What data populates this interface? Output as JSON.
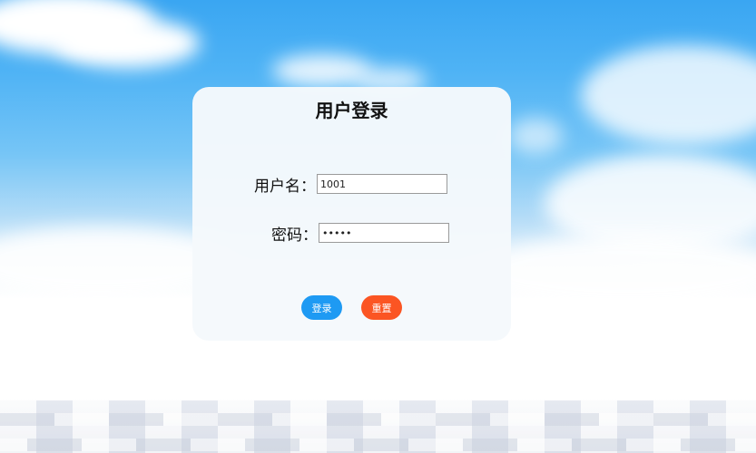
{
  "login": {
    "title": "用户登录",
    "username_label": "用户名：",
    "username_value": "1001",
    "password_label": "密码：",
    "password_value": "12345",
    "login_button": "登录",
    "reset_button": "重置"
  },
  "colors": {
    "login_button": "#1e9af3",
    "reset_button": "#fb5523",
    "sky": "#3aa6f2"
  }
}
